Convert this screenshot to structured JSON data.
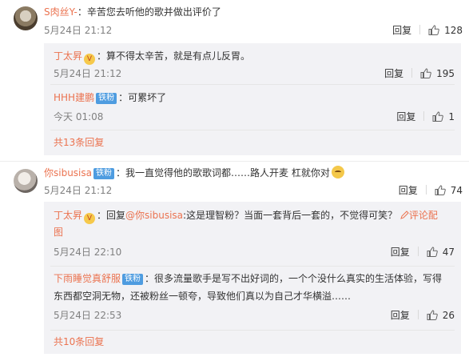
{
  "comments": [
    {
      "user": "S肉丝Y-",
      "text": "：辛苦您去听他的歌并做出评价了",
      "time": "5月24日 21:12",
      "reply_label": "回复",
      "likes": "128",
      "replies": [
        {
          "user": "丁太昇",
          "text": "：算不得太辛苦，就是有点儿反胃。",
          "time": "5月24日 21:12",
          "reply_label": "回复",
          "likes": "195"
        },
        {
          "user": "HHH建鹏",
          "badge": "铁粉",
          "text": "：可累坏了",
          "time": "今天 01:08",
          "reply_label": "回复",
          "likes": "1"
        }
      ],
      "more": "共13条回复"
    },
    {
      "user": "你sibusisa",
      "badge": "铁粉",
      "text": "：我一直觉得他的歌歌词都……路人开麦 杠就你对",
      "time": "5月24日 21:12",
      "reply_label": "回复",
      "likes": "74",
      "replies": [
        {
          "user": "丁太昇",
          "text_prefix": "：回复",
          "mention": "@你sibusisa",
          "text": ":这是理智粉？当面一套背后一套的，不觉得可笑？",
          "report": "评论配",
          "text_line2": "图",
          "time": "5月24日 22:10",
          "reply_label": "回复",
          "likes": "47"
        },
        {
          "user": "下雨睡觉真舒服",
          "badge": "铁粉",
          "text": "：很多流量歌手是写不出好词的，一个个没什么真实的生活体验，写得",
          "text_line2": "东西都空洞无物，还被粉丝一顿夸，导致他们真以为自己才华横溢……",
          "time": "5月24日 22:53",
          "reply_label": "回复",
          "likes": "26"
        }
      ],
      "more": "共10条回复"
    }
  ],
  "icons": {
    "like": "thumbs-up-icon",
    "report": "pencil-icon",
    "verified": "orange-v-badge-icon"
  },
  "colors": {
    "username": "#eb7350",
    "badge": "#4e9ce0",
    "sub_bg": "#f2f2f5"
  }
}
